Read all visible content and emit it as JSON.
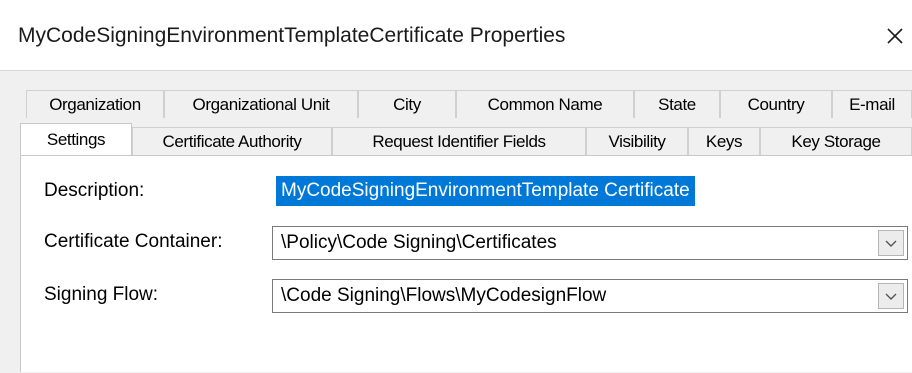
{
  "window": {
    "title": "MyCodeSigningEnvironmentTemplateCertificate Properties",
    "close_glyph": "✕"
  },
  "tabs": {
    "row1": [
      "Organization",
      "Organizational Unit",
      "City",
      "Common Name",
      "State",
      "Country",
      "E-mail"
    ],
    "row2": [
      "Settings",
      "Certificate Authority",
      "Request Identifier Fields",
      "Visibility",
      "Keys",
      "Key Storage"
    ],
    "selected": "Settings"
  },
  "form": {
    "description_label": "Description:",
    "description_value": "MyCodeSigningEnvironmentTemplate Certificate",
    "container_label": "Certificate Container:",
    "container_value": "\\Policy\\Code Signing\\Certificates",
    "flow_label": "Signing Flow:",
    "flow_value": "\\Code Signing\\Flows\\MyCodesignFlow"
  },
  "icons": {
    "close": "close-icon",
    "dropdown": "chevron-down-icon"
  },
  "colors": {
    "selection": "#0078d7",
    "dialog_bg": "#f0f0f0"
  }
}
